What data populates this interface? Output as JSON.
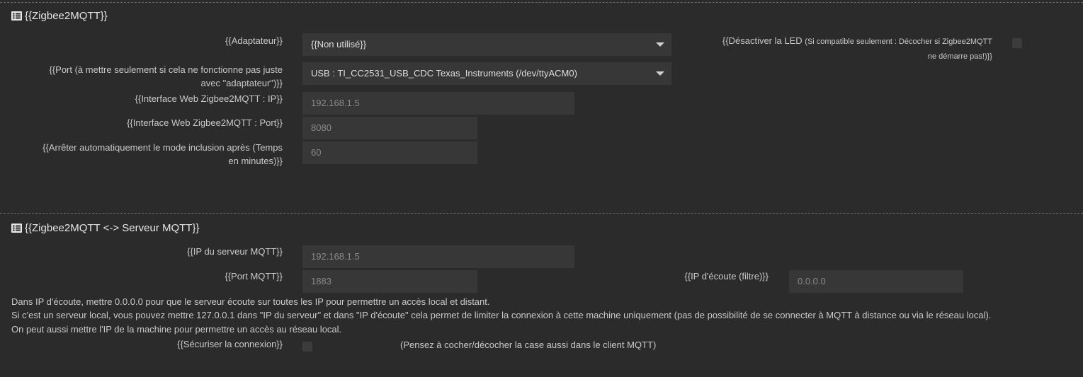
{
  "section1": {
    "title": "{{Zigbee2MQTT}}",
    "adapter_label": "{{Adaptateur}}",
    "adapter_value": "{{Non utilisé}}",
    "port_label_line1": "{{Port (à mettre seulement si cela ne fonctionne pas juste",
    "port_label_line2": "avec \"adaptateur\")}}",
    "port_value": "USB : TI_CC2531_USB_CDC Texas_Instruments (/dev/ttyACM0)",
    "webip_label": "{{Interface Web Zigbee2MQTT : IP}}",
    "webip_value": "192.168.1.5",
    "webport_label": "{{Interface Web Zigbee2MQTT : Port}}",
    "webport_value": "8080",
    "inclusion_label_line1": "{{Arrêter automatiquement le mode inclusion après (Temps",
    "inclusion_label_line2": "en minutes)}}",
    "inclusion_value": "60",
    "led_label": "{{Désactiver la LED",
    "led_hint_line1": "(Si compatible seulement : Décocher si Zigbee2MQTT",
    "led_hint_line2": "ne démarre pas!)}}"
  },
  "section2": {
    "title": "{{Zigbee2MQTT <-> Serveur MQTT}}",
    "mqtt_ip_label": "{{IP du serveur MQTT}}",
    "mqtt_ip_value": "192.168.1.5",
    "mqtt_port_label": "{{Port MQTT}}",
    "mqtt_port_value": "1883",
    "listen_ip_label": "{{IP d'écoute (filtre)}}",
    "listen_ip_value": "0.0.0.0",
    "note_line1": "Dans IP d'écoute, mettre 0.0.0.0 pour que le serveur écoute sur toutes les IP pour permettre un accès local et distant.",
    "note_line2": "Si c'est un serveur local, vous pouvez mettre 127.0.0.1 dans \"IP du serveur\" et dans \"IP d'écoute\" cela permet de limiter la connexion à cette machine uniquement (pas de possibilité de se connecter à MQTT à distance ou via le réseau local).",
    "note_line3": "On peut aussi mettre l'IP de la machine pour permettre un accès au réseau local.",
    "secure_label": "{{Sécuriser la connexion}}",
    "secure_hint": "(Pensez à cocher/décocher la case aussi dans le client MQTT)"
  },
  "icons": {
    "legend": "list-icon"
  }
}
